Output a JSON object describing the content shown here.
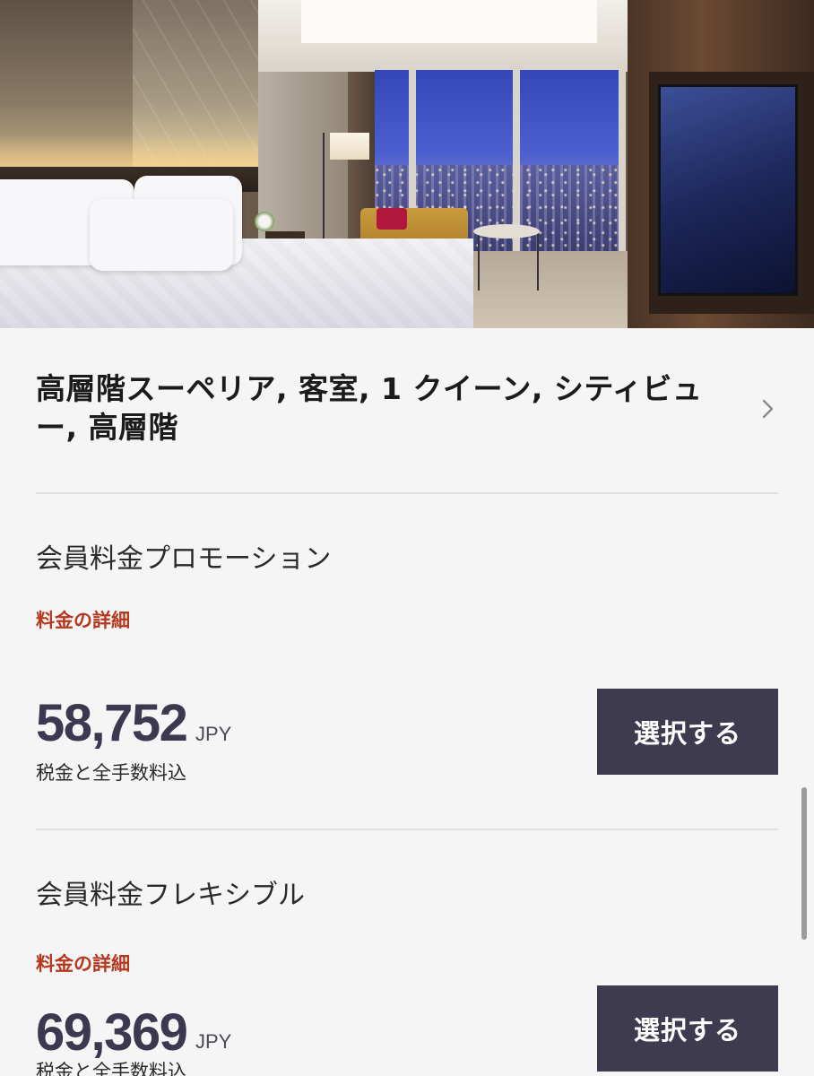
{
  "room": {
    "title": "高層階スーペリア, 客室, 1 クイーン, シティビュー, 高層階"
  },
  "rates": [
    {
      "name": "会員料金プロモーション",
      "details_link": "料金の詳細",
      "price": "58,752",
      "currency": "JPY",
      "tax_note": "税金と全手数料込",
      "select_label": "選択する"
    },
    {
      "name": "会員料金フレキシブル",
      "details_link": "料金の詳細",
      "price": "69,369",
      "currency": "JPY",
      "tax_note": "税金と全手数料込",
      "select_label": "選択する"
    }
  ],
  "icons": {
    "chevron": "chevron-right-icon"
  },
  "colors": {
    "accent_link": "#b5381e",
    "button_bg": "#3e3a50",
    "price_text": "#3b3950",
    "background": "#f5f5f5"
  }
}
